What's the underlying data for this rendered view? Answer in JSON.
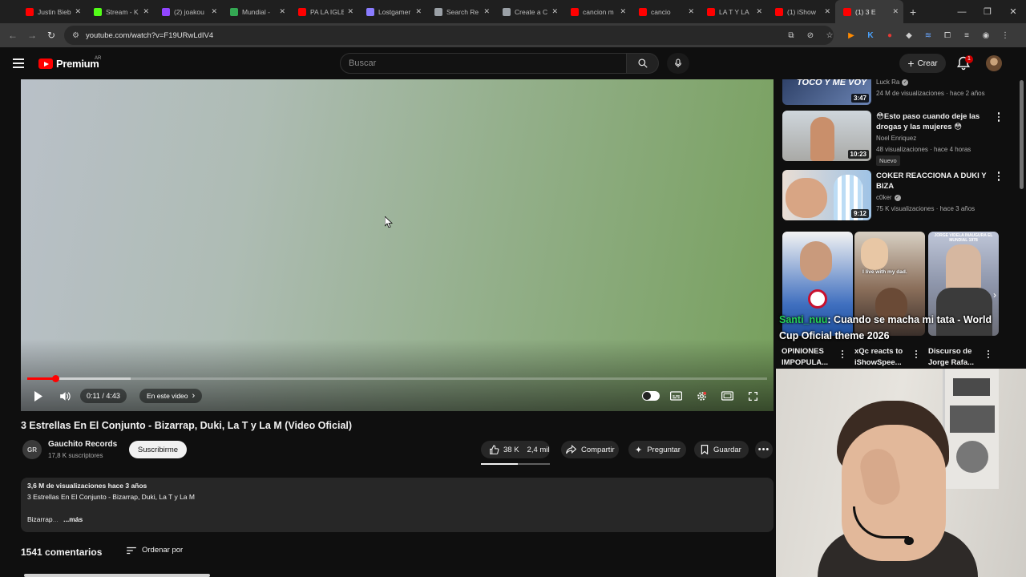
{
  "browser": {
    "tabs": [
      {
        "label": "Justin Bieb",
        "icon": "youtube-icon",
        "color": "#ff0000"
      },
      {
        "label": "Stream - K",
        "icon": "kick-icon",
        "color": "#53fc18"
      },
      {
        "label": "(2) joakou",
        "icon": "twitch-icon",
        "color": "#9146ff"
      },
      {
        "label": "Mundial -",
        "icon": "globe-icon",
        "color": "#34a853"
      },
      {
        "label": "PA LA IGLE",
        "icon": "youtube-icon",
        "color": "#ff0000"
      },
      {
        "label": "Lostgamer",
        "icon": "g-icon",
        "color": "#8a7cff"
      },
      {
        "label": "Search Re",
        "icon": "doc-icon",
        "color": "#9aa0a6"
      },
      {
        "label": "Create a C",
        "icon": "doc-icon",
        "color": "#9aa0a6"
      },
      {
        "label": "cancion m",
        "icon": "youtube-icon",
        "color": "#ff0000"
      },
      {
        "label": "cancio",
        "icon": "youtube-icon",
        "color": "#ff0000"
      },
      {
        "label": "LA T Y LA",
        "icon": "youtube-icon",
        "color": "#ff0000"
      },
      {
        "label": "(1) iShow",
        "icon": "youtube-icon",
        "color": "#ff0000"
      },
      {
        "label": "(1) 3 E",
        "icon": "youtube-icon",
        "color": "#ff0000",
        "active": true
      }
    ],
    "url": "youtube.com/watch?v=F19URwLdIV4"
  },
  "header": {
    "brand": "Premium",
    "country": "AR",
    "search_placeholder": "Buscar",
    "create_label": "Crear",
    "notifications_count": "1"
  },
  "player": {
    "progress_fraction": 0.039,
    "buffer_fraction": 0.14,
    "time": "0:11 / 4:43",
    "chapter": "En este video",
    "chapter_arrow": "›"
  },
  "video": {
    "title": "3 Estrellas En El Conjunto - Bizarrap, Duki, La T y La M (Video Oficial)",
    "channel_initials": "GR",
    "channel_name": "Gauchito Records",
    "channel_subs": "17,8 K suscriptores",
    "subscribe_label": "Suscribirme",
    "likes": "38 K",
    "dislikes": "2,4 mil",
    "share_label": "Compartir",
    "ask_label": "Preguntar",
    "save_label": "Guardar",
    "like_ratio": 0.54,
    "description_meta": "3,6 M de visualizaciones  hace 3 años",
    "description_line": "3 Estrellas En El Conjunto - Bizarrap, Duki, La T y La M",
    "description_snippet": "Bizarrap",
    "description_fade": "...",
    "more_label": "...más"
  },
  "comments": {
    "count_label": "1541 comentarios",
    "sort_label": "Ordenar por"
  },
  "sidebar": {
    "recs": [
      {
        "thumb_text": "TOCO Y ME VOY",
        "duration": "3:47",
        "title": "",
        "channel": "Luck Ra",
        "verified": true,
        "meta": "24 M de visualizaciones · hace 2 años"
      },
      {
        "duration": "10:23",
        "title": "😳Esto paso cuando deje  las drogas y las mujeres 😳",
        "channel": "Noel Enriquez",
        "meta": "48 visualizaciones · hace 4 horas",
        "badge": "Nuevo"
      },
      {
        "duration": "9:12",
        "title": "COKER REACCIONA A DUKI Y BIZA",
        "channel": "c0ker",
        "verified": true,
        "meta": "75 K visualizaciones · hace 3 años"
      }
    ],
    "shorts": [
      {
        "title": "OPINIONES IMPOPULA...",
        "caption": "I live with my dad."
      },
      {
        "title": "xQc reacts to iShowSpee..."
      },
      {
        "title": "Discurso de Jorge Rafa...",
        "poster_text": "JORGE VIDELA INAUGURA EL MUNDIAL 1978"
      }
    ],
    "overlay_handle": "Santi_nuu",
    "overlay_text": ": Cuando se macha mi tata - World Cup Oficial theme 2026"
  }
}
